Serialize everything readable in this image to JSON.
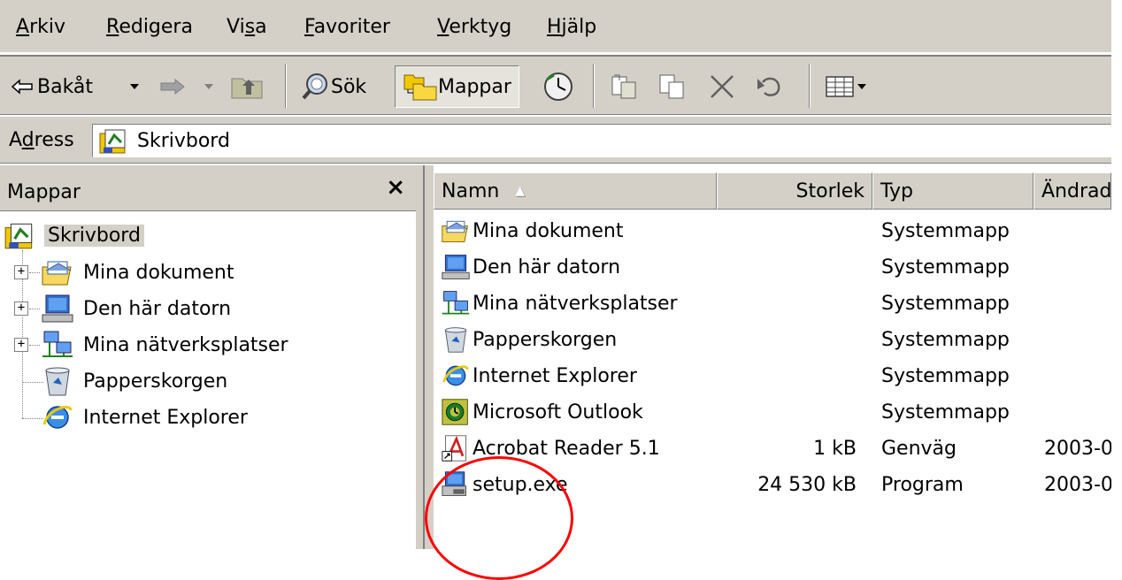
{
  "menu": [
    {
      "key": "A",
      "rest": "rkiv"
    },
    {
      "key": "R",
      "rest": "edigera"
    },
    {
      "pre": "Vi",
      "key": "s",
      "rest": "a"
    },
    {
      "key": "F",
      "rest": "avoriter"
    },
    {
      "key": "V",
      "rest": "erktyg"
    },
    {
      "key": "H",
      "rest": "jälp"
    }
  ],
  "toolbar": {
    "back_label": "Bakåt",
    "search_label": "Sök",
    "folders_label": "Mappar"
  },
  "address": {
    "label_pre": "A",
    "label_key": "d",
    "label_rest": "ress",
    "value": "Skrivbord"
  },
  "folders_pane": {
    "title": "Mappar",
    "close_glyph": "×",
    "root": "Skrivbord",
    "items": [
      {
        "label": "Mina dokument",
        "icon": "my-documents-icon",
        "expander": "+"
      },
      {
        "label": "Den här datorn",
        "icon": "my-computer-icon",
        "expander": "+"
      },
      {
        "label": "Mina nätverksplatser",
        "icon": "network-places-icon",
        "expander": "+"
      },
      {
        "label": "Papperskorgen",
        "icon": "recycle-bin-icon",
        "expander": ""
      },
      {
        "label": "Internet Explorer",
        "icon": "internet-explorer-icon",
        "expander": ""
      }
    ]
  },
  "file_list": {
    "columns": [
      "Namn",
      "Storlek",
      "Typ",
      "Ändrad"
    ],
    "sort_indicator": "▲",
    "rows": [
      {
        "name": "Mina dokument",
        "size": "",
        "type": "Systemmapp",
        "date": "",
        "icon": "my-documents-icon"
      },
      {
        "name": "Den här datorn",
        "size": "",
        "type": "Systemmapp",
        "date": "",
        "icon": "my-computer-icon"
      },
      {
        "name": "Mina nätverksplatser",
        "size": "",
        "type": "Systemmapp",
        "date": "",
        "icon": "network-places-icon"
      },
      {
        "name": "Papperskorgen",
        "size": "",
        "type": "Systemmapp",
        "date": "",
        "icon": "recycle-bin-icon"
      },
      {
        "name": "Internet Explorer",
        "size": "",
        "type": "Systemmapp",
        "date": "",
        "icon": "internet-explorer-icon"
      },
      {
        "name": "Microsoft Outlook",
        "size": "",
        "type": "Systemmapp",
        "date": "",
        "icon": "outlook-icon"
      },
      {
        "name": "Acrobat Reader 5.1",
        "size": "1 kB",
        "type": "Genväg",
        "date": "2003-0",
        "icon": "acrobat-shortcut-icon"
      },
      {
        "name": "setup.exe",
        "size": "24 530 kB",
        "type": "Program",
        "date": "2003-0",
        "icon": "setup-exe-icon"
      }
    ]
  },
  "colors": {
    "chrome": "#d4d0c8",
    "annotation": "#ff0000"
  }
}
